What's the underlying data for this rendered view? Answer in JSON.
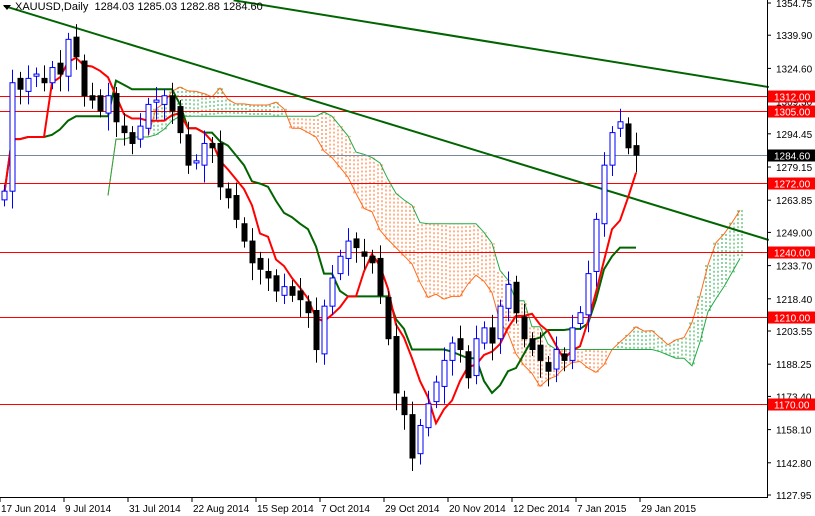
{
  "header": {
    "symbol": "XAUUSD,Daily",
    "open": "1284.03",
    "high": "1285.03",
    "low": "1282.88",
    "close": "1284.60"
  },
  "chart_data": {
    "type": "candlestick",
    "title": "XAUUSD,Daily",
    "ylim": [
      1127.95,
      1354.75
    ],
    "y_ticks": [
      "1354.75",
      "1339.90",
      "1324.60",
      "1309.30",
      "1294.45",
      "1279.15",
      "1263.85",
      "1249.00",
      "1233.70",
      "1218.40",
      "1203.55",
      "1188.25",
      "1173.40",
      "1158.10",
      "1142.80",
      "1127.95"
    ],
    "x_ticks": [
      "17 Jun 2014",
      "9 Jul 2014",
      "31 Jul 2014",
      "22 Aug 2014",
      "15 Sep 2014",
      "7 Oct 2014",
      "29 Oct 2014",
      "20 Nov 2014",
      "12 Dec 2014",
      "7 Jan 2015",
      "29 Jan 2015"
    ],
    "bars_per_tick": 8,
    "closes": [
      1268,
      1318,
      1315,
      1320,
      1322,
      1318,
      1325,
      1322,
      1338,
      1330,
      1312,
      1310,
      1305,
      1312,
      1300,
      1295,
      1290,
      1298,
      1308,
      1310,
      1312,
      1305,
      1295,
      1280,
      1282,
      1290,
      1288,
      1270,
      1265,
      1255,
      1245,
      1235,
      1232,
      1228,
      1222,
      1224,
      1220,
      1218,
      1212,
      1195,
      1215,
      1228,
      1238,
      1245,
      1242,
      1238,
      1235,
      1220,
      1200,
      1175,
      1165,
      1145,
      1160,
      1170,
      1180,
      1190,
      1198,
      1195,
      1182,
      1200,
      1205,
      1198,
      1215,
      1225,
      1212,
      1200,
      1195,
      1190,
      1185,
      1195,
      1190,
      1205,
      1212,
      1230,
      1255,
      1280,
      1295,
      1300,
      1288,
      1284.6
    ],
    "horizontal_levels": [
      {
        "price": 1312.0,
        "label": "1312.00",
        "color": "#ff0000"
      },
      {
        "price": 1305.0,
        "label": "1305.00",
        "color": "#ff0000"
      },
      {
        "price": 1272.0,
        "label": "1272.00",
        "color": "#ff0000"
      },
      {
        "price": 1240.0,
        "label": "1240.00",
        "color": "#ff0000"
      },
      {
        "price": 1210.0,
        "label": "1210.00",
        "color": "#ff0000"
      },
      {
        "price": 1170.0,
        "label": "1170.00",
        "color": "#ff0000"
      }
    ],
    "current_price": {
      "price": 1284.6,
      "label": "1284.60"
    },
    "trendlines": [
      {
        "from_bar": 0,
        "from_price": 1353.4,
        "to_bar": 95.6,
        "to_price": 1245.5,
        "color": "#006400"
      },
      {
        "from_bar": 28.7,
        "from_price": 1356.0,
        "to_bar": 95.6,
        "to_price": 1316.0,
        "color": "#006400"
      }
    ],
    "indicator": "Ichimoku",
    "colors": {
      "bull_body": "#ffffff",
      "bull_line": "#0000ff",
      "bear_body": "#000000",
      "tenkan": "#ff0000",
      "kijun": "#006400",
      "cloud_bear": "#ff6a1a",
      "cloud_bull": "#22aa44",
      "grid_axis": "#000000"
    }
  }
}
